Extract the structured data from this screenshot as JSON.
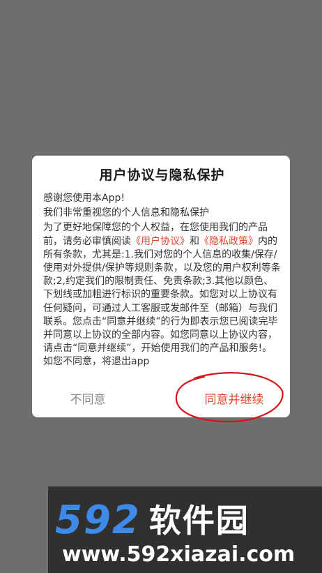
{
  "dialog": {
    "title": "用户协议与隐私保护",
    "intro_line1": "感谢您使用本App!",
    "intro_line2": "我们非常重视您的个人信息和隐私保护",
    "para_a": "为了更好地保障您的个人权益，在您使用我们的产品前，请务必审慎阅读",
    "user_agreement_link": "《用户协议》",
    "para_and": "和",
    "privacy_policy_link": "《隐私政策》",
    "para_b": "内的所有条款，尤其是:1.我们对您的个人信息的收集/保存/使用对外提供/保护等规则条款，以及您的用户权利等条款;2,约定我们的限制责任、免责条款;3.其他以颜色、下划线或加粗进行标识的重要条款。如您对以上协议有任何疑问，可通过人工客服或发邮件至（邮箱）与我们联系。您点击“同意并继续”的行为即表示您已阅读完毕并同意以上协议的全部内容。如您同意以上协议内容，请点击“同意并继续”，开始使用我们的产品和服务!。",
    "para_c": "如您不同意，将退出app",
    "decline_label": "不同意",
    "accept_label": "同意并继续"
  },
  "watermark": {
    "number": "592",
    "name": "软件园",
    "url": "www.592xiazai.com"
  },
  "colors": {
    "overlay": "#6e6e6e",
    "link": "#e0452c",
    "accept": "#e0452c",
    "decline": "#888888",
    "ellipse": "#d8141a",
    "watermark_blue": "#3d8ae8"
  }
}
